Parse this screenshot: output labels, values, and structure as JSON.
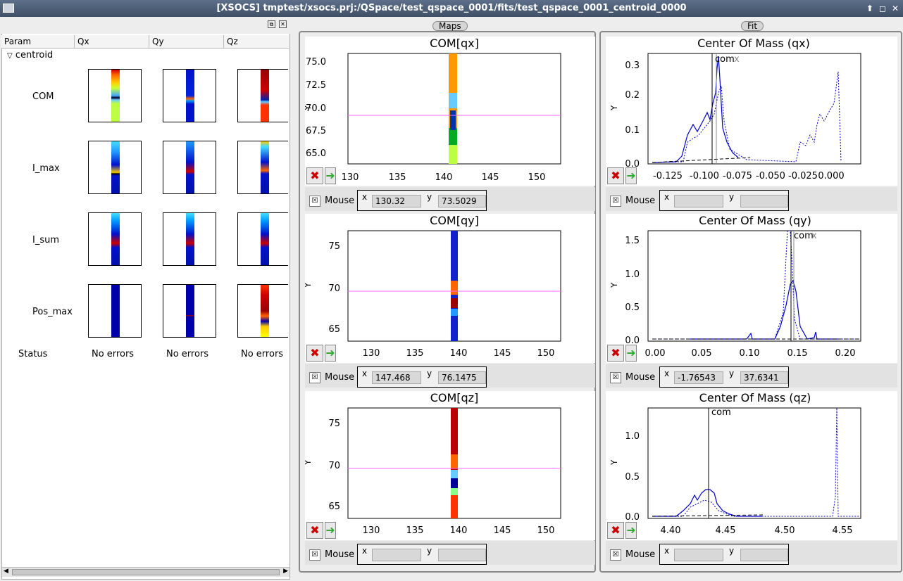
{
  "window": {
    "title": "[XSOCS] tmptest/xsocs.prj:/QSpace/test_qspace_0001/fits/test_qspace_0001_centroid_0000"
  },
  "left": {
    "columns": [
      "Param",
      "Qx",
      "Qy",
      "Qz"
    ],
    "node": "centroid",
    "rows": [
      "COM",
      "I_max",
      "I_sum",
      "Pos_max"
    ],
    "status_label": "Status",
    "status": [
      "No errors",
      "No errors",
      "No errors"
    ]
  },
  "maps": {
    "title": "Maps",
    "plots": [
      {
        "title": "COM[qx]",
        "ylabel": "Y",
        "xticks": [
          "130",
          "135",
          "140",
          "145",
          "150"
        ],
        "yticks": [
          "75.0",
          "72.5",
          "70.0",
          "67.5",
          "65.0"
        ],
        "mouse_label": "Mouse",
        "x_label": "x",
        "y_label": "y",
        "x_value": "130.32",
        "y_value": "73.5029"
      },
      {
        "title": "COM[qy]",
        "ylabel": "Y",
        "xticks": [
          "130",
          "135",
          "140",
          "145",
          "150"
        ],
        "yticks": [
          "75",
          "70",
          "65"
        ],
        "mouse_label": "Mouse",
        "x_label": "x",
        "y_label": "y",
        "x_value": "147.468",
        "y_value": "76.1475"
      },
      {
        "title": "COM[qz]",
        "ylabel": "Y",
        "xticks": [
          "130",
          "135",
          "140",
          "145",
          "150"
        ],
        "yticks": [
          "75",
          "70",
          "65"
        ],
        "mouse_label": "Mouse",
        "x_label": "x",
        "y_label": "y",
        "x_value": "",
        "y_value": ""
      }
    ]
  },
  "fit": {
    "title": "Fit",
    "plots": [
      {
        "title": "Center Of Mass (qx)",
        "ylabel": "Y",
        "xticks": [
          "-0.125",
          "-0.100",
          "-0.075",
          "-0.050",
          "-0.025",
          "0.000"
        ],
        "yticks": [
          "0.3",
          "0.2",
          "0.1",
          "0.0"
        ],
        "annotation": "com",
        "annotation2": "x",
        "mouse_label": "Mouse",
        "x_label": "x",
        "y_label": "y",
        "x_value": "",
        "y_value": ""
      },
      {
        "title": "Center Of Mass (qy)",
        "ylabel": "Y",
        "xticks": [
          "0.00",
          "0.05",
          "0.10",
          "0.15",
          "0.20"
        ],
        "yticks": [
          "1.5",
          "1.0",
          "0.5",
          "0.0"
        ],
        "annotation": "com",
        "annotation2": "x",
        "mouse_label": "Mouse",
        "x_label": "x",
        "y_label": "y",
        "x_value": "-1.76543",
        "y_value": "37.6341"
      },
      {
        "title": "Center Of Mass (qz)",
        "ylabel": "Y",
        "xticks": [
          "4.40",
          "4.45",
          "4.50",
          "4.55"
        ],
        "yticks": [
          "1.0",
          "0.5",
          "0.0"
        ],
        "annotation": "com",
        "annotation2": "",
        "mouse_label": "Mouse",
        "x_label": "x",
        "y_label": "y",
        "x_value": "",
        "y_value": ""
      }
    ]
  },
  "icons": {
    "reset": "red-x-icon",
    "next": "green-arrow-icon",
    "dock": "float-icon",
    "close": "close-icon"
  },
  "colors": {
    "crosshair": "#ff66ff",
    "fit_line": "#0000cc",
    "title_grad_top": "#5d6f89"
  }
}
